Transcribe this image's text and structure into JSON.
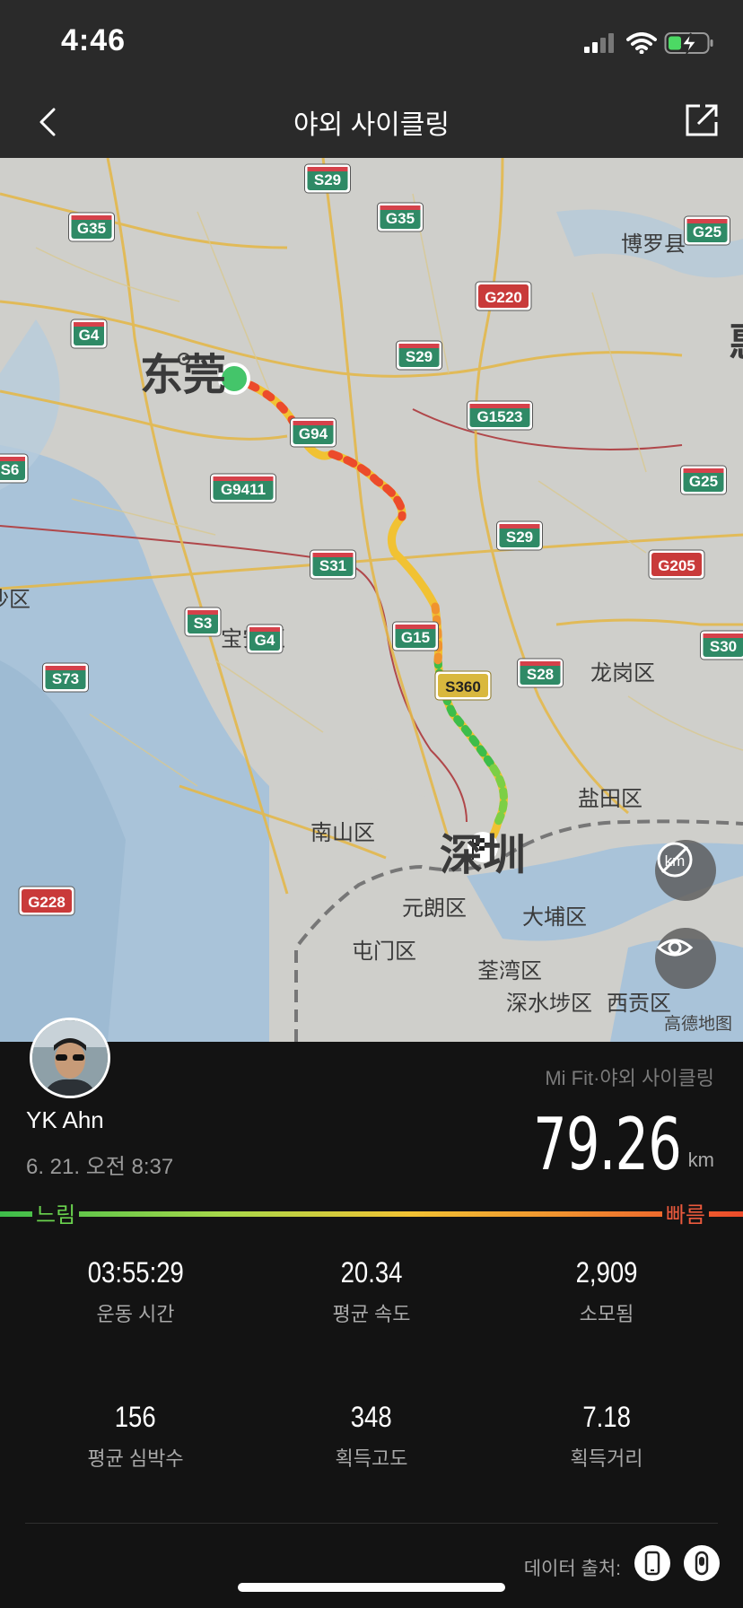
{
  "status_bar": {
    "time": "4:46"
  },
  "nav": {
    "title": "야외 사이클링"
  },
  "map": {
    "city_labels": [
      "东莞",
      "深圳",
      "博罗县",
      "宝安区",
      "龙岗区",
      "盐田区",
      "南山区",
      "元朗区",
      "大埔区",
      "屯门区",
      "荃湾区",
      "深水埗区",
      "西贡区",
      "沙区",
      "惠"
    ],
    "road_badges": [
      "S29",
      "G35",
      "G35",
      "G25",
      "G220",
      "G4",
      "S29",
      "G1523",
      "G94",
      "S6",
      "G9411",
      "G25",
      "S29",
      "G205",
      "S31",
      "S3",
      "G4",
      "G15",
      "S30",
      "S73",
      "S360",
      "S28",
      "G228"
    ],
    "watermark": "高德地图",
    "route_colors": {
      "slow": "#3dbd4a",
      "mid": "#f1c233",
      "fast": "#ec4b2b"
    }
  },
  "profile": {
    "name": "YK Ahn",
    "datetime": "6. 21. 오전 8:37",
    "source": "Mi Fit·야외 사이클링"
  },
  "distance": {
    "value": "79.26",
    "unit": "km"
  },
  "speed_legend": {
    "slow": "느림",
    "fast": "빠름"
  },
  "stats": [
    {
      "value": "03:55:29",
      "label": "운동 시간"
    },
    {
      "value": "20.34",
      "label": "평균 속도"
    },
    {
      "value": "2,909",
      "label": "소모됨"
    },
    {
      "value": "156",
      "label": "평균 심박수"
    },
    {
      "value": "348",
      "label": "획득고도"
    },
    {
      "value": "7.18",
      "label": "획득거리"
    }
  ],
  "data_source_label": "데이터 출처:"
}
